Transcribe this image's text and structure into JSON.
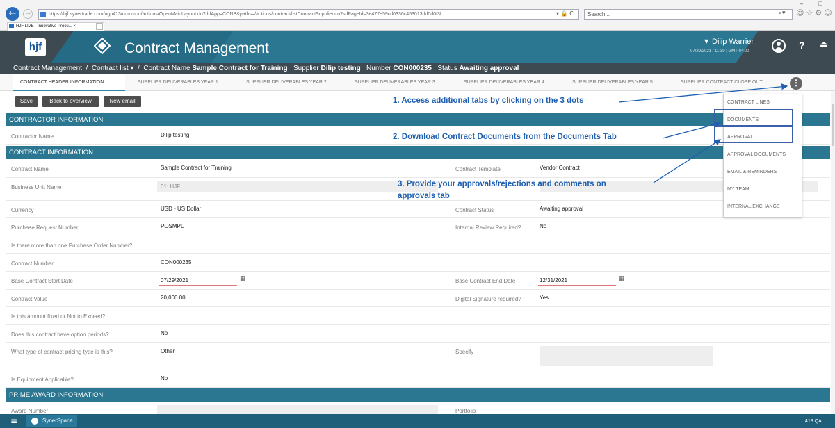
{
  "browser": {
    "back_glyph": "←",
    "forward_glyph": "→",
    "url": "https://hjf.synertrade.com/ngp413/common/actions/OpenMainLayout.do?ddApp=CONB&paths=/actions/contract/listContractSupplier.do?sdPageId=3e477e59cd0336c453013dd0d0f3f",
    "address_tools": "▾ 🔒 C",
    "search_placeholder": "Search...",
    "search_glyph": "⌕▾",
    "toolbar_icons": "☺☆⚙☺",
    "window_controls": "– □",
    "tab_title": "HJF LIVE - Innovative Procu... ×"
  },
  "header": {
    "logo_text": "hjf",
    "app_title": "Contract Management",
    "user_caret": "▼",
    "user_name": "Dilip Warrier",
    "user_datetime": "07/29/2021 / 11:39 | GMT-04:00",
    "help_label": "?",
    "logout_glyph": "⏏"
  },
  "breadcrumb": {
    "home": "Contract Management",
    "sep1": "/",
    "list": "Contract list ▾",
    "sep2": "/",
    "name_label": "Contract Name",
    "name_value": "Sample Contract for Training",
    "supplier_label": "Supplier",
    "supplier_value": "Dilip testing",
    "number_label": "Number",
    "number_value": "CON000235",
    "status_label": "Status",
    "status_value": "Awaiting approval"
  },
  "tabs": [
    {
      "label": "CONTRACT HEADER INFORMATION"
    },
    {
      "label": "SUPPLIER DELIVERABLES YEAR 1"
    },
    {
      "label": "SUPPLIER DELIVERABLES YEAR 2"
    },
    {
      "label": "SUPPLIER DELIVERABLES YEAR 3"
    },
    {
      "label": "SUPPLIER DELIVERABLES YEAR 4"
    },
    {
      "label": "SUPPLIER DELIVERABLES YEAR 5"
    },
    {
      "label": "SUPPLIER CONTRACT CLOSE OUT"
    }
  ],
  "more_tabs_glyph": "⋮",
  "toolbar": {
    "save": "Save",
    "back": "Back to overview",
    "new_email": "New email"
  },
  "annotations": {
    "a1": "1. Access additional tabs by clicking on the 3 dots",
    "a2": "2. Download Contract Documents from the Documents Tab",
    "a3_line1": "3. Provide your approvals/rejections and comments  on",
    "a3_line2": "approvals tab"
  },
  "menu": [
    "CONTRACT LINES",
    "DOCUMENTS",
    "APPROVAL",
    "APPROVAL DOCUMENTS",
    "EMAIL & REMINDERS",
    "MY TEAM",
    "INTERNAL EXCHANGE"
  ],
  "sections": {
    "contractor": "CONTRACTOR INFORMATION",
    "contract": "CONTRACT INFORMATION",
    "prime": "PRIME AWARD INFORMATION"
  },
  "contractor": {
    "name_label": "Contractor Name",
    "name_value": "Dilip testing"
  },
  "fields": {
    "contract_name_label": "Contract Name",
    "contract_name_value": "Sample Contract for Training",
    "template_label": "Contract Template",
    "template_value": "Vendor Contract",
    "bu_label": "Business Unit Name",
    "bu_value": "01: HJF",
    "currency_label": "Currency",
    "currency_value": "USD - US Dollar",
    "status_label": "Contract Status",
    "status_value": "Awaiting approval",
    "pr_label": "Purchase Request Number",
    "pr_value": "POSMPL",
    "review_label": "Internal Review Required?",
    "review_value": "No",
    "multi_po_label": "Is there more than one Purchase Order Number?",
    "number_label": "Contract Number",
    "number_value": "CON000235",
    "start_label": "Base Contract Start Date",
    "start_value": "07/29/2021",
    "end_label": "Base Contract End Date",
    "end_value": "12/31/2021",
    "value_label": "Contract Value",
    "value_value": "20,000.00",
    "sig_label": "Digital Signature required?",
    "sig_value": "Yes",
    "fixed_label": "Is this amount fixed or Not to Exceed?",
    "option_label": "Does this contract have option periods?",
    "option_value": "No",
    "pricing_label": "What type of contract pricing type is this?",
    "pricing_value": "Other",
    "specify_label": "Specify",
    "equip_label": "Is Equipment Applicable?",
    "equip_value": "No",
    "award_label": "Award Number",
    "portfolio_label": "Portfolio"
  },
  "calendar_glyph": "▦",
  "taskbar": {
    "menu_glyph": "≡",
    "app_label": "SynerSpace",
    "version": "413 QA"
  },
  "colors": {
    "header_dark": "#3e4a52",
    "header_teal": "#2b7690",
    "section_teal": "#2b7690",
    "annotation_blue": "#1e5fb0",
    "taskbar": "#1f5f7a"
  }
}
